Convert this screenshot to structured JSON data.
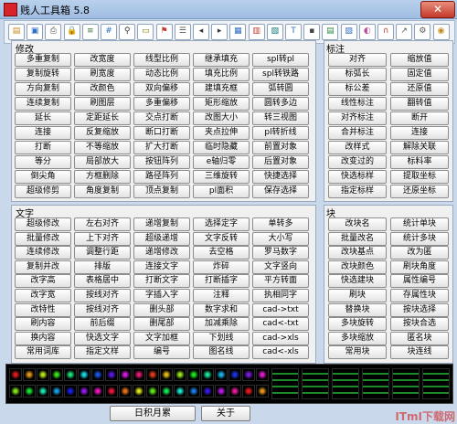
{
  "window": {
    "title": "贱人工具箱 5.8",
    "close_symbol": "✕"
  },
  "toolbar_icons": [
    "folder-icon",
    "block-icon",
    "printer-icon",
    "lock-icon",
    "layer-icon",
    "grid-icon",
    "zoom-icon",
    "ruler-icon",
    "flag-icon",
    "layer-list-icon",
    "prev-arrow-icon",
    "next-arrow-icon",
    "layout-icon",
    "table-icon",
    "chart-icon",
    "text-icon",
    "chip-icon",
    "table2-icon",
    "image-icon",
    "color-icon",
    "magnet-icon",
    "arrow-icon",
    "gear-icon",
    "car-icon"
  ],
  "sections": {
    "modify": "修改",
    "dimension": "标注",
    "text": "文字",
    "block": "块"
  },
  "modify_buttons": [
    [
      "多重复制",
      "改宽度",
      "线型比例",
      "继承填充",
      "spl转pl"
    ],
    [
      "复制旋转",
      "刷宽度",
      "动态比例",
      "填充比例",
      "spl转铁路"
    ],
    [
      "方向复制",
      "改颜色",
      "双向偏移",
      "建填充框",
      "弧转圆"
    ],
    [
      "连续复制",
      "刷图层",
      "多重偏移",
      "矩形缩放",
      "圆转多边"
    ],
    [
      "延长",
      "定距延长",
      "交点打断",
      "改图大小",
      "转三视图"
    ],
    [
      "连接",
      "反复缩放",
      "断口打断",
      "夹点拉伸",
      "pl转折线"
    ],
    [
      "打断",
      "不等缩放",
      "扩大打断",
      "临时隐藏",
      "前置对象"
    ],
    [
      "等分",
      "局部放大",
      "按钮阵列",
      "e轴归零",
      "后置对象"
    ],
    [
      "倒尖角",
      "方框删除",
      "路径阵列",
      "三维旋转",
      "快捷选择"
    ],
    [
      "超级修剪",
      "角度复制",
      "顶点复制",
      "pl面积",
      "保存选择"
    ]
  ],
  "dimension_buttons": [
    [
      "对齐",
      "缩放值"
    ],
    [
      "标弧长",
      "固定值"
    ],
    [
      "标公差",
      "还原值"
    ],
    [
      "线性标注",
      "翻转值"
    ],
    [
      "对齐标注",
      "断开"
    ],
    [
      "合并标注",
      "连接"
    ],
    [
      "改样式",
      "解除关联"
    ],
    [
      "改变过的",
      "标料率"
    ],
    [
      "快选标样",
      "提取坐标"
    ],
    [
      "指定标样",
      "还原坐标"
    ]
  ],
  "text_buttons": [
    [
      "超级修改",
      "左右对齐",
      "递增复制",
      "选择定字",
      "单转多"
    ],
    [
      "批量修改",
      "上下对齐",
      "超级递增",
      "文字反转",
      "大小写"
    ],
    [
      "连续修改",
      "调整行距",
      "递增修改",
      "去空格",
      "罗马数字"
    ],
    [
      "复制并改",
      "排版",
      "连接文字",
      "炸碎",
      "文字竖向"
    ],
    [
      "改字高",
      "表格居中",
      "打断文字",
      "打断插字",
      "平方转面"
    ],
    [
      "改字宽",
      "按线对齐",
      "字插入字",
      "注释",
      "执相同字"
    ],
    [
      "改特性",
      "按线对齐",
      "删头部",
      "数字求和",
      "cad->txt"
    ],
    [
      "刷内容",
      "前后缀",
      "删尾部",
      "加减乘除",
      "cad<-txt"
    ],
    [
      "换内容",
      "快选文字",
      "文字加框",
      "下划线",
      "cad->xls"
    ],
    [
      "常用词库",
      "指定文样",
      "编号",
      "图名线",
      "cad<-xls"
    ]
  ],
  "block_buttons": [
    [
      "改块名",
      "统计单块"
    ],
    [
      "批量改名",
      "统计多块"
    ],
    [
      "改块基点",
      "改为匿"
    ],
    [
      "改块颜色",
      "刷块角度"
    ],
    [
      "快选建块",
      "属性编号"
    ],
    [
      "刷块",
      "存属性块"
    ],
    [
      "替换块",
      "按块选择"
    ],
    [
      "多块旋转",
      "按块合选"
    ],
    [
      "多块缩放",
      "匿名块"
    ],
    [
      "常用块",
      "块连线"
    ]
  ],
  "bottom_buttons": {
    "daily": "日积月累",
    "about": "关于"
  },
  "watermark": "ITmI下载网",
  "colors": {
    "accent": "#d8232a",
    "panel": "#f0f0f0",
    "bg": "#c9d8ea"
  }
}
